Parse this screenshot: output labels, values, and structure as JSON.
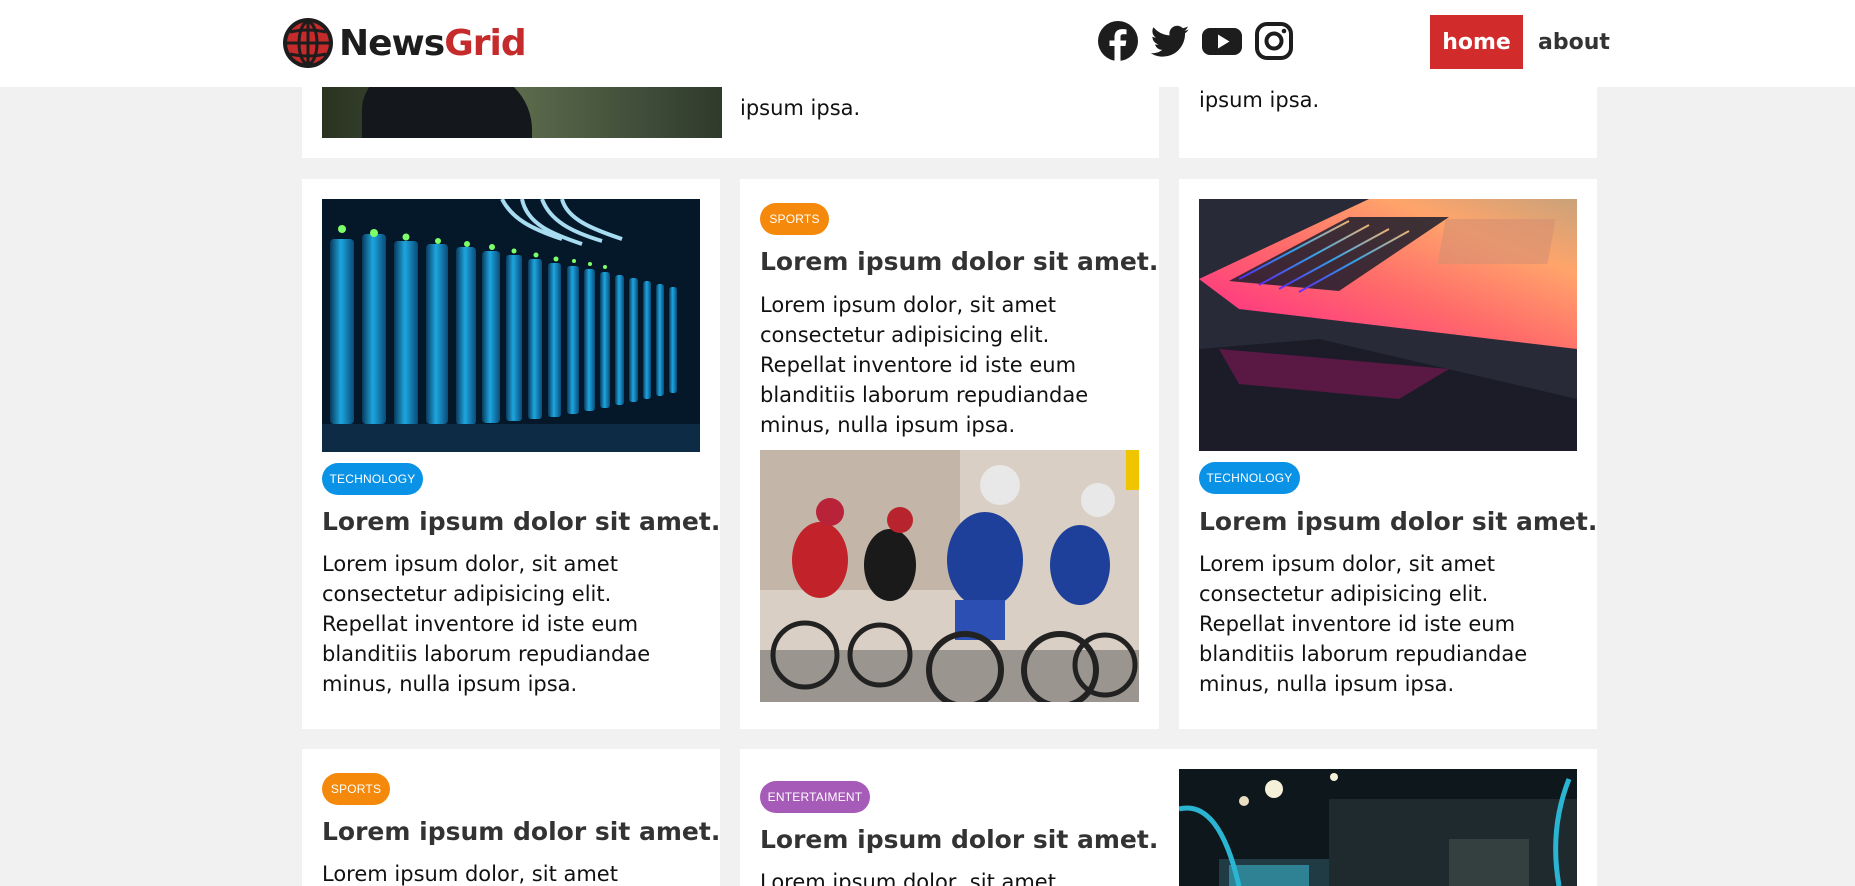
{
  "header": {
    "logo_part1": "News",
    "logo_part2": "Grid",
    "social_icons": [
      "facebook-icon",
      "twitter-icon",
      "youtube-icon",
      "instagram-icon"
    ],
    "nav": {
      "home": "home",
      "about": "about"
    }
  },
  "colors": {
    "brand_red": "#d12b2b",
    "technology": "#0a93e6",
    "sports": "#f5890b",
    "entertainment": "#a75bb8",
    "background": "#f1f1f1"
  },
  "cards": [
    {
      "body_tail": "ipsum ipsa."
    },
    {
      "body_tail": "ipsum ipsa."
    },
    {
      "tag": "TECHNOLOGY",
      "title": "Lorem ipsum dolor sit amet.",
      "body": "Lorem ipsum dolor, sit amet consectetur adipisicing elit. Repellat inventore id iste eum blanditiis laborum repudiandae minus, nulla ipsum ipsa."
    },
    {
      "tag": "SPORTS",
      "title": "Lorem ipsum dolor sit amet.",
      "body": "Lorem ipsum dolor, sit amet consectetur adipisicing elit. Repellat inventore id iste eum blanditiis laborum repudiandae minus, nulla ipsum ipsa."
    },
    {
      "tag": "TECHNOLOGY",
      "title": "Lorem ipsum dolor sit amet.",
      "body": "Lorem ipsum dolor, sit amet consectetur adipisicing elit. Repellat inventore id iste eum blanditiis laborum repudiandae minus, nulla ipsum ipsa."
    },
    {
      "tag": "SPORTS",
      "title": "Lorem ipsum dolor sit amet.",
      "body": "Lorem ipsum dolor, sit amet"
    },
    {
      "tag": "ENTERTAIMENT",
      "title": "Lorem ipsum dolor sit amet.",
      "body": "Lorem ipsum dolor, sit amet"
    }
  ]
}
